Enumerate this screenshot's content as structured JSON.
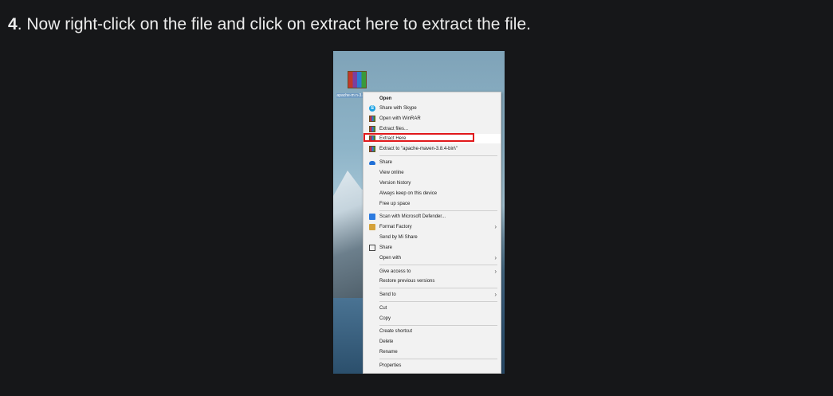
{
  "instruction": {
    "step_number": "4",
    "text": ". Now right-click on the file and click on extract here to extract the file."
  },
  "desktop": {
    "icon_label": "apache-m\nn-3.8.4"
  },
  "context_menu": {
    "items": [
      {
        "label": "Open",
        "icon": "none",
        "bold": true
      },
      {
        "label": "Share with Skype",
        "icon": "skype-icon"
      },
      {
        "label": "Open with WinRAR",
        "icon": "winrar-icon"
      },
      {
        "label": "Extract files...",
        "icon": "winrar-icon"
      },
      {
        "label": "Extract Here",
        "icon": "winrar-icon",
        "highlighted": true
      },
      {
        "label": "Extract to \"apache-maven-3.8.4-bin\\\"",
        "icon": "winrar-icon"
      },
      {
        "label": "Share",
        "icon": "onedrive-icon"
      },
      {
        "label": "View online"
      },
      {
        "label": "Version history"
      },
      {
        "label": "Always keep on this device"
      },
      {
        "label": "Free up space"
      },
      {
        "label": "Scan with Microsoft Defender...",
        "icon": "defender-icon"
      },
      {
        "label": "Format Factory",
        "icon": "format-factory-icon",
        "submenu": true
      },
      {
        "label": "Send by Mi Share"
      },
      {
        "label": "Share",
        "icon": "share-icon"
      },
      {
        "label": "Open with",
        "submenu": true
      },
      {
        "label": "Give access to",
        "submenu": true
      },
      {
        "label": "Restore previous versions"
      },
      {
        "label": "Send to",
        "submenu": true
      },
      {
        "label": "Cut"
      },
      {
        "label": "Copy"
      },
      {
        "label": "Create shortcut"
      },
      {
        "label": "Delete"
      },
      {
        "label": "Rename"
      },
      {
        "label": "Properties"
      }
    ],
    "highlight_color": "#e0181b"
  }
}
